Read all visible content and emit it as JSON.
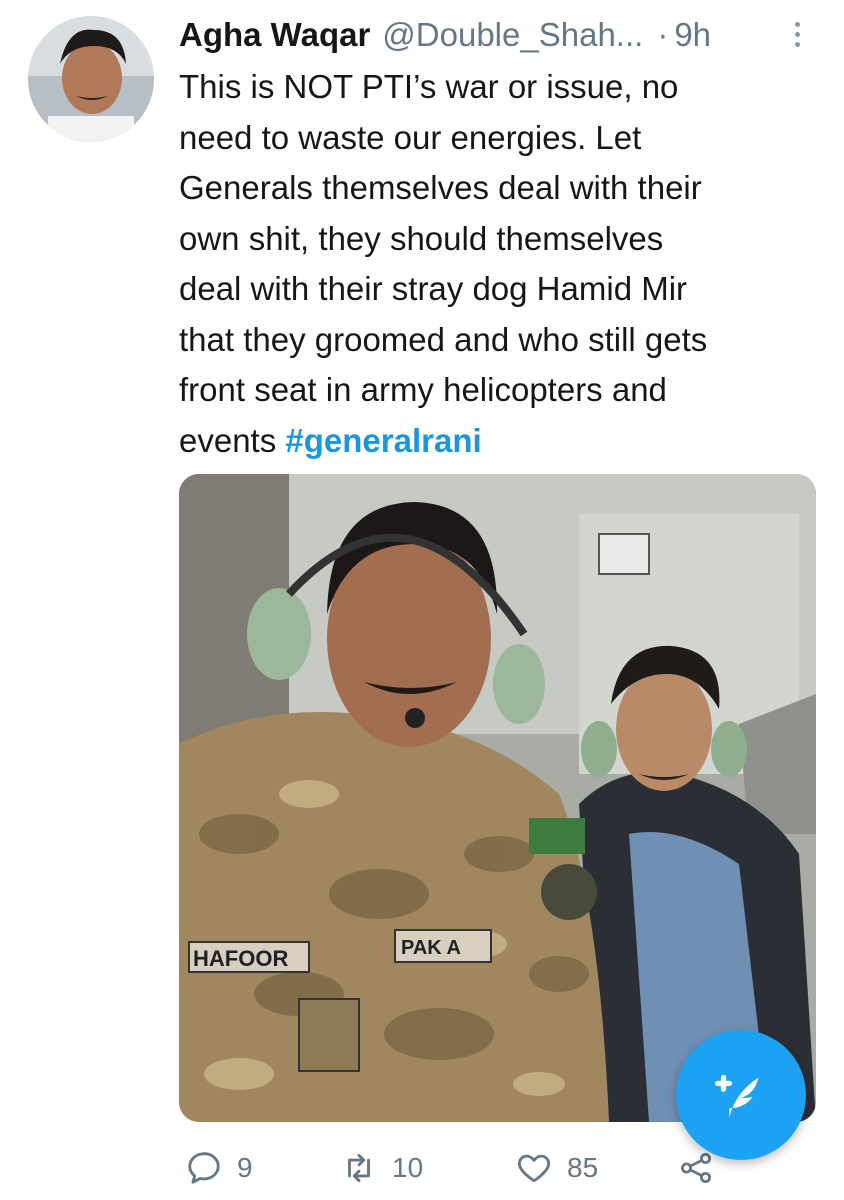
{
  "tweet": {
    "display_name": "Agha Waqar",
    "handle": "@Double_Shah...",
    "separator": "·",
    "time": "9h",
    "text": "This is NOT PTI’s war or issue, no\nneed to waste our energies. Let\nGenerals themselves deal with their\nown shit, they should themselves\ndeal with their stray dog Hamid Mir\nthat they groomed  and who still gets\nfront seat in army helicopters and\nevents ",
    "hashtag": "#generalrani",
    "media_patches": {
      "left_name_tape": "HAFOOR",
      "right_name_tape": "PAK A"
    }
  },
  "actions": {
    "reply_count": "9",
    "retweet_count": "10",
    "like_count": "85"
  },
  "icons": {
    "more": "more-vertical-icon",
    "reply": "reply-icon",
    "retweet": "retweet-icon",
    "like": "heart-icon",
    "share": "share-icon",
    "compose": "compose-tweet-icon"
  },
  "colors": {
    "link": "#1b95e0",
    "accent": "#1da1f2",
    "muted": "#657786"
  }
}
